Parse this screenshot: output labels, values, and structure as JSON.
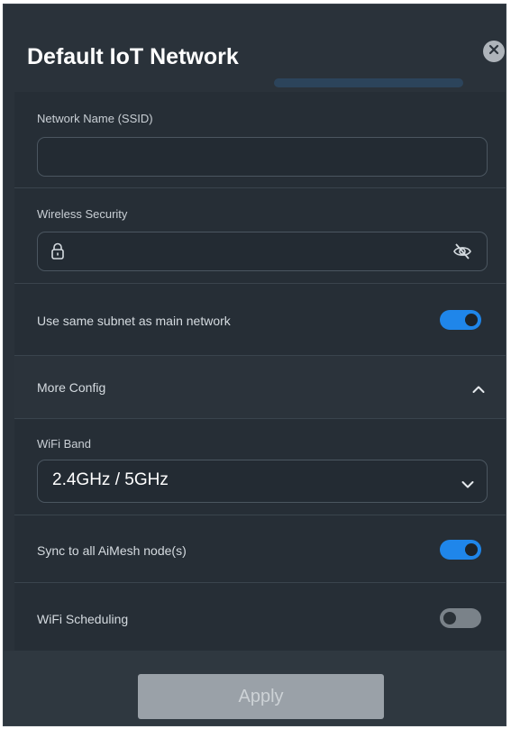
{
  "dialog": {
    "title": "Default IoT Network",
    "close_icon": "close-icon"
  },
  "ssid": {
    "label": "Network Name (SSID)",
    "value": "",
    "placeholder": ""
  },
  "security": {
    "label": "Wireless Security",
    "value": "",
    "lock_icon": "lock-icon",
    "visibility_icon": "eye-off-icon"
  },
  "same_subnet": {
    "label": "Use same subnet as main network",
    "enabled": true
  },
  "more_config": {
    "label": "More Config",
    "expanded": true,
    "icon": "chevron-up-icon"
  },
  "wifi_band": {
    "label": "WiFi Band",
    "selected": "2.4GHz / 5GHz",
    "icon": "chevron-down-icon"
  },
  "sync_aimesh": {
    "label": "Sync to all AiMesh node(s)",
    "enabled": true
  },
  "wifi_scheduling": {
    "label": "WiFi Scheduling",
    "enabled": false
  },
  "footer": {
    "apply_label": "Apply"
  },
  "colors": {
    "background": "#2a323a",
    "panel": "#262e36",
    "accent": "#1f86ea",
    "toggle_off": "#7a8289",
    "apply_disabled": "#9aa1a8"
  }
}
